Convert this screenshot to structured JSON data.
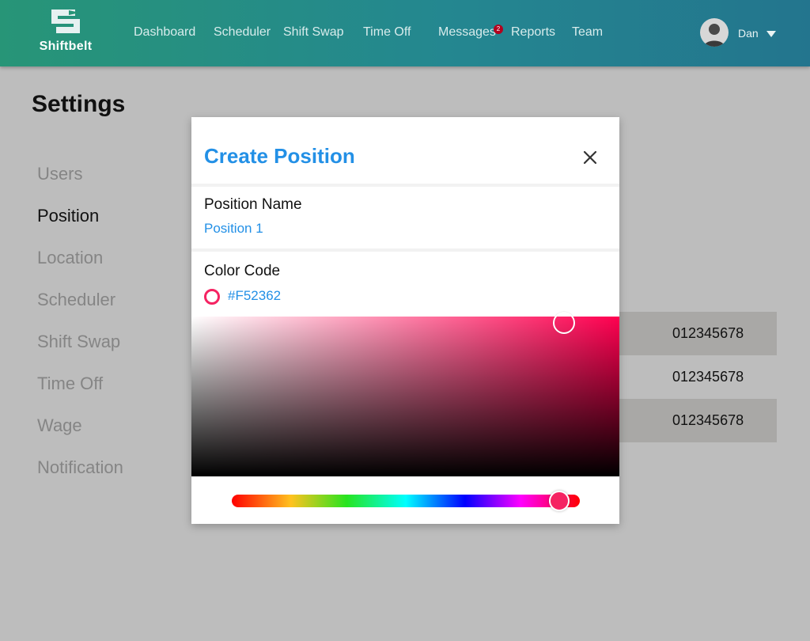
{
  "brand": {
    "name": "Shiftbelt"
  },
  "nav": {
    "items": [
      "Dashboard",
      "Scheduler",
      "Shift Swap",
      "Time Off",
      "Messages",
      "Reports",
      "Team"
    ],
    "messages_badge": "2"
  },
  "user": {
    "name": "Dan"
  },
  "page": {
    "title": "Settings"
  },
  "sidebar": {
    "items": [
      "Users",
      "Position",
      "Location",
      "Scheduler",
      "Shift Swap",
      "Time Off",
      "Wage",
      "Notification"
    ],
    "active": "Position"
  },
  "table": {
    "values": [
      "012345678",
      "012345678",
      "012345678"
    ]
  },
  "modal": {
    "title": "Create Position",
    "position_name_label": "Position Name",
    "position_name_value": "Position 1",
    "color_code_label": "Color Code",
    "color_code_value": "#F52362"
  },
  "color_picker": {
    "hue_fraction": 0.94,
    "saturation": 0.87,
    "value": 0.96
  },
  "colors": {
    "accent": "#2390E6",
    "selected_color": "#F52362",
    "header_start": "#279577",
    "header_end": "#23758E",
    "badge": "#B3001E"
  },
  "icons": {
    "logo": "shiftbelt-logo-icon",
    "close": "close-icon",
    "caret": "chevron-down-icon",
    "avatar": "user-avatar-icon"
  }
}
